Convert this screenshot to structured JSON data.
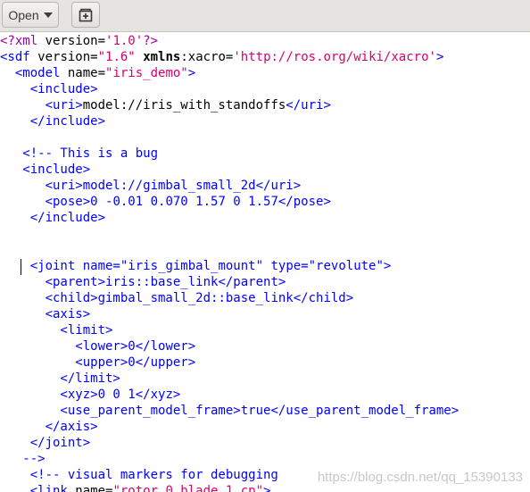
{
  "toolbar": {
    "open_label": "Open"
  },
  "editor": {
    "lines": {
      "l1": [
        "<?xml ",
        "version=",
        "'1.0'",
        "?>"
      ],
      "l2": [
        "<sdf ",
        "version=",
        "\"1.6\"",
        " ",
        "xmlns",
        ":xacro=",
        "'http://ros.org/wiki/xacro'",
        ">"
      ],
      "l3": [
        "  <model ",
        "name=",
        "\"iris_demo\"",
        ">"
      ],
      "l4": [
        "    <include>"
      ],
      "l5": [
        "      <uri>",
        "model://iris_with_standoffs",
        "</uri>"
      ],
      "l6": [
        "    </include>"
      ],
      "l8": [
        "   <!-- This is a bug"
      ],
      "l9": [
        "   <include>"
      ],
      "l10": [
        "      <uri>",
        "model://gimbal_small_2d",
        "</uri>"
      ],
      "l11": [
        "      <pose>",
        "0 -0.01 0.070 1.57 0 1.57",
        "</pose>"
      ],
      "l12": [
        "    </include>"
      ],
      "l15": [
        "    <joint ",
        "name=",
        "\"iris_gimbal_mount\"",
        " ",
        "type=",
        "\"revolute\"",
        ">"
      ],
      "l16": [
        "      <parent>",
        "iris::base_link",
        "</parent>"
      ],
      "l17": [
        "      <child>",
        "gimbal_small_2d::base_link",
        "</child>"
      ],
      "l18": [
        "      <axis>"
      ],
      "l19": [
        "        <limit>"
      ],
      "l20": [
        "          <lower>",
        "0",
        "</lower>"
      ],
      "l21": [
        "          <upper>",
        "0",
        "</upper>"
      ],
      "l22": [
        "        </limit>"
      ],
      "l23": [
        "        <xyz>",
        "0 0 1",
        "</xyz>"
      ],
      "l24": [
        "        <use_parent_model_frame>",
        "true",
        "</use_parent_model_frame>"
      ],
      "l25": [
        "      </axis>"
      ],
      "l26": [
        "    </joint>"
      ],
      "l27": [
        "   -->"
      ],
      "l28": [
        "    <!-- visual markers for debugging"
      ],
      "l29": [
        "    <link ",
        "name=",
        "\"rotor_0_blade_1_cp\"",
        ">"
      ]
    }
  },
  "watermark": "https://blog.csdn.net/qq_15390133",
  "colors": {
    "tag": "#0000ff",
    "attr_value": "#d6006f",
    "pi": "#a000a0",
    "text": "#000000"
  }
}
